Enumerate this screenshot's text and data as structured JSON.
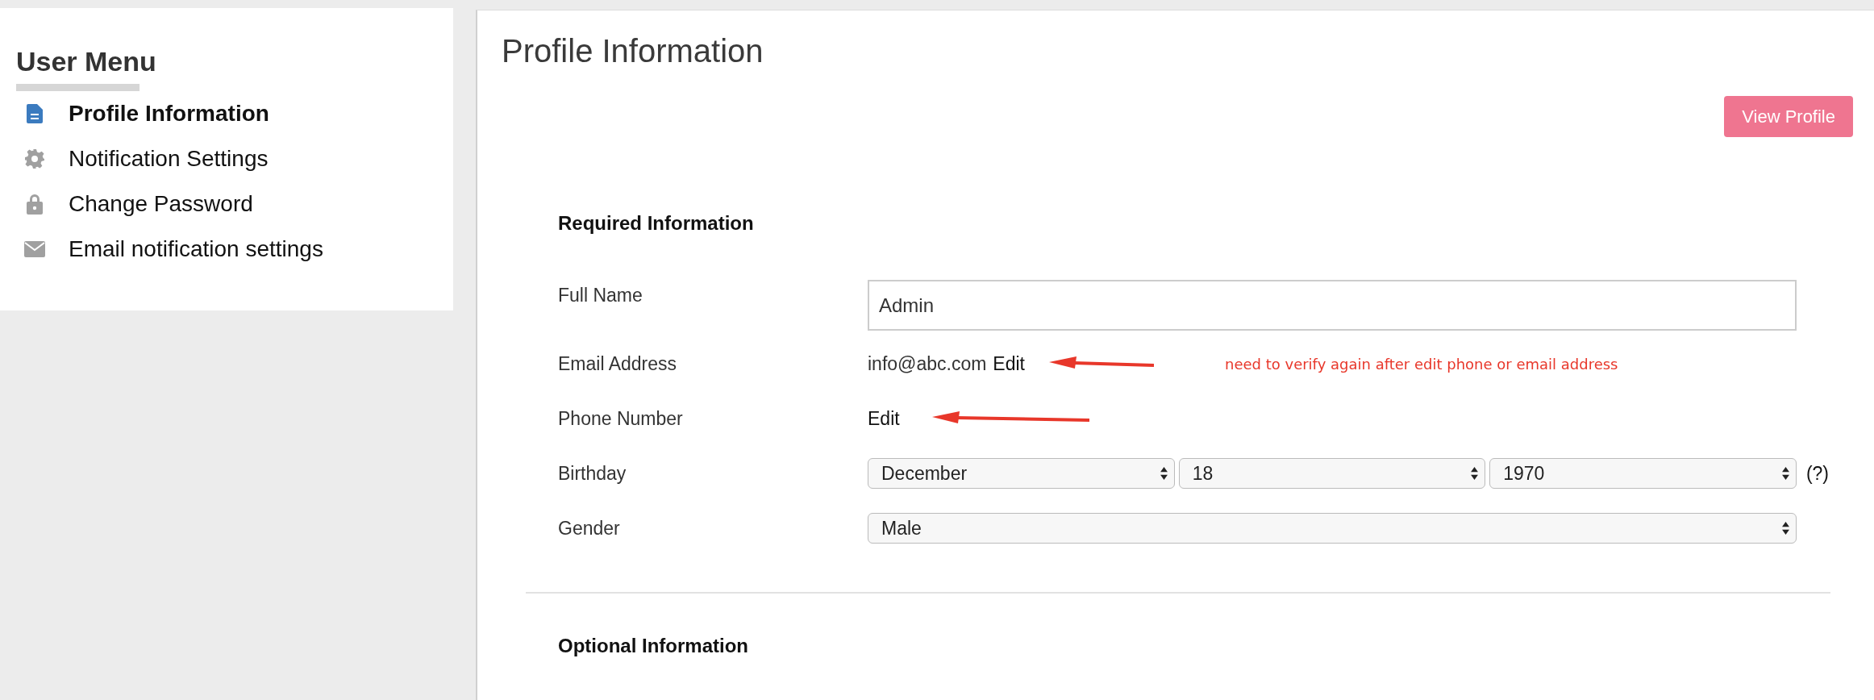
{
  "sidebar": {
    "title": "User Menu",
    "items": [
      {
        "label": "Profile Information",
        "selected": true
      },
      {
        "label": "Notification Settings",
        "selected": false
      },
      {
        "label": "Change Password",
        "selected": false
      },
      {
        "label": "Email notification settings",
        "selected": false
      }
    ]
  },
  "main": {
    "title": "Profile Information",
    "view_button": "View Profile",
    "required_section": {
      "heading": "Required Information",
      "fields": [
        {
          "kind": "input",
          "label": "Full Name",
          "value": "Admin"
        },
        {
          "kind": "text_link",
          "label": "Email Address",
          "value": "info@abc.com",
          "link": "Edit",
          "note": "need to verify again after edit phone or email address"
        },
        {
          "kind": "link",
          "label": "Phone Number",
          "link": "Edit"
        },
        {
          "kind": "select_group",
          "label": "Birthday",
          "selects": [
            "December",
            "18",
            "1970"
          ],
          "help": "(?)"
        },
        {
          "kind": "select",
          "label": "Gender",
          "selects": [
            "Male"
          ]
        }
      ]
    },
    "optional_section": {
      "heading": "Optional Information"
    }
  }
}
